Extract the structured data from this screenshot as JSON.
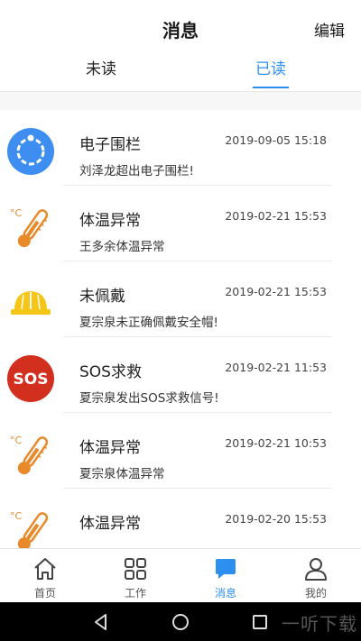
{
  "header": {
    "title": "消息",
    "edit_label": "编辑"
  },
  "tabs": [
    {
      "label": "未读",
      "active": false
    },
    {
      "label": "已读",
      "active": true
    }
  ],
  "messages": [
    {
      "icon": "geofence-icon",
      "title": "电子围栏",
      "time": "2019-09-05 15:18",
      "desc": "刘泽龙超出电子围栏!"
    },
    {
      "icon": "thermometer-icon",
      "title": "体温异常",
      "time": "2019-02-21 15:53",
      "desc": "王多余体温异常"
    },
    {
      "icon": "hardhat-icon",
      "title": "未佩戴",
      "time": "2019-02-21 15:53",
      "desc": "夏宗泉未正确佩戴安全帽!"
    },
    {
      "icon": "sos-icon",
      "title": "SOS求救",
      "time": "2019-02-21 11:53",
      "desc": "夏宗泉发出SOS求救信号!",
      "icon_text": "SOS"
    },
    {
      "icon": "thermometer-icon",
      "title": "体温异常",
      "time": "2019-02-21 10:53",
      "desc": "夏宗泉体温异常"
    },
    {
      "icon": "thermometer-icon",
      "title": "体温异常",
      "time": "2019-02-20 15:53",
      "desc": ""
    }
  ],
  "nav": [
    {
      "icon": "home-icon",
      "label": "首页",
      "active": false
    },
    {
      "icon": "grid-icon",
      "label": "工作",
      "active": false
    },
    {
      "icon": "message-icon",
      "label": "消息",
      "active": true
    },
    {
      "icon": "user-icon",
      "label": "我的",
      "active": false
    }
  ],
  "watermark": "一听下载",
  "colors": {
    "accent": "#2d8ff0",
    "thermometer": "#e8892a",
    "hardhat": "#f5c518",
    "sos": "#d32f1f",
    "geofence": "#3d8ef0"
  }
}
